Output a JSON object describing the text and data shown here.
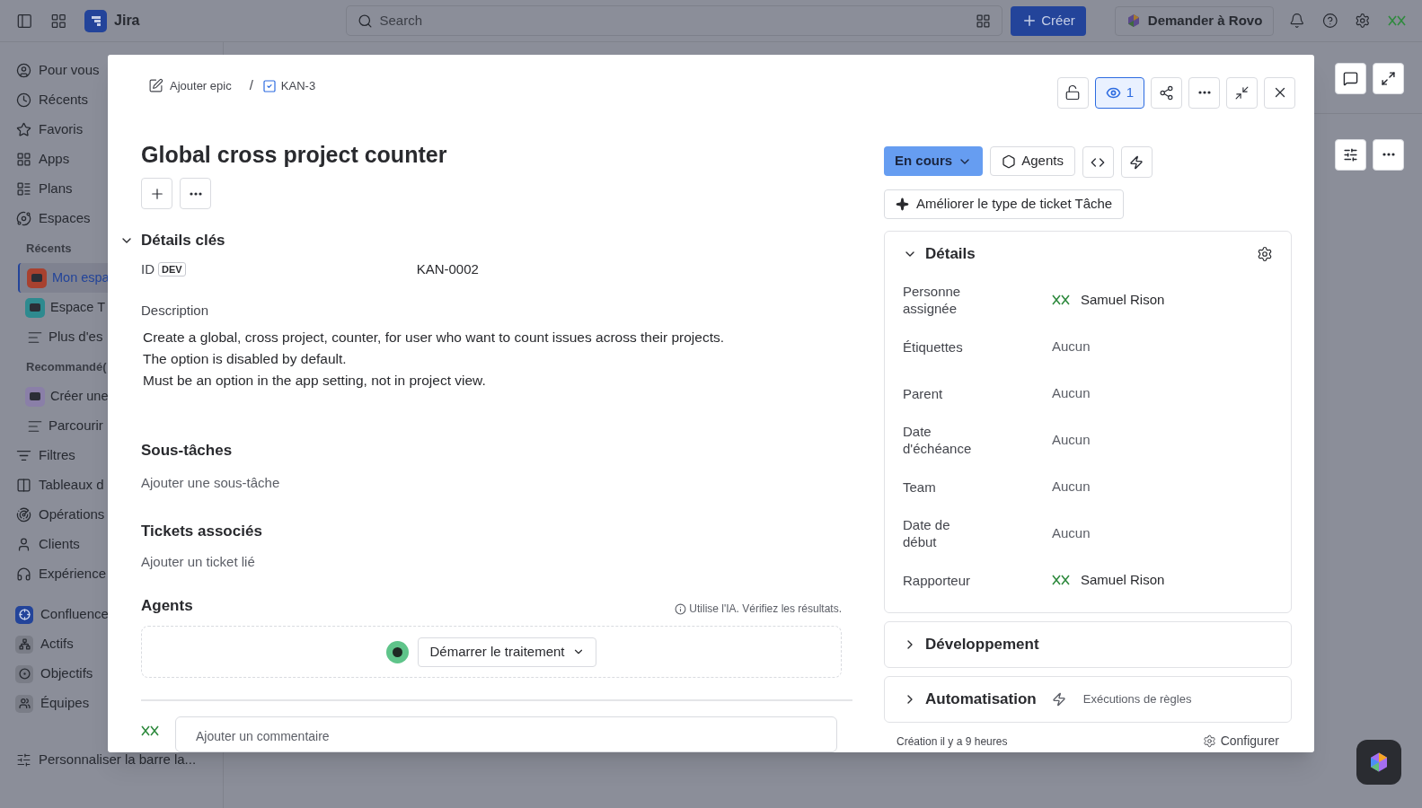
{
  "topbar": {
    "app_name": "Jira",
    "search": {
      "placeholder": "Search"
    },
    "create": "Créer",
    "rovo": "Demander à Rovo"
  },
  "sidebar": {
    "items": [
      {
        "kind": "item",
        "label": "Pour vous",
        "selected": false
      },
      {
        "kind": "item",
        "label": "Récents",
        "selected": false
      },
      {
        "kind": "item",
        "label": "Favoris",
        "selected": false
      },
      {
        "kind": "item",
        "label": "Apps",
        "selected": false
      },
      {
        "kind": "item",
        "label": "Plans",
        "selected": false
      },
      {
        "kind": "item",
        "label": "Espaces",
        "selected": false
      },
      {
        "kind": "heading",
        "label": "Récents"
      },
      {
        "kind": "space",
        "label": "Mon espa",
        "color": "#a8412f",
        "selected": true
      },
      {
        "kind": "space",
        "label": "Espace T",
        "color": "#2e8a8f",
        "selected": false
      },
      {
        "kind": "sub",
        "label": "Plus d'es",
        "selected": false
      },
      {
        "kind": "heading",
        "label": "Recommandé("
      },
      {
        "kind": "space",
        "label": "Créer une",
        "color": "#8a7fa8",
        "selected": false
      },
      {
        "kind": "sub",
        "label": "Parcourir",
        "selected": false
      },
      {
        "kind": "item",
        "label": "Filtres",
        "selected": false
      },
      {
        "kind": "item",
        "label": "Tableaux d",
        "selected": false
      },
      {
        "kind": "item",
        "label": "Opérations",
        "selected": false
      },
      {
        "kind": "item",
        "label": "Clients",
        "selected": false
      },
      {
        "kind": "item",
        "label": "Expérience",
        "selected": false
      },
      {
        "kind": "app",
        "label": "Confluence",
        "color": "#23449a",
        "selected": false
      },
      {
        "kind": "app",
        "label": "Actifs",
        "color": "#7a7d87",
        "selected": false
      },
      {
        "kind": "app",
        "label": "Objectifs",
        "color": "#7a7d87",
        "selected": false
      },
      {
        "kind": "app",
        "label": "Équipes",
        "color": "#7a7d87",
        "selected": false
      }
    ],
    "customize": "Personnaliser la barre la..."
  },
  "issue": {
    "breadcrumbs": [
      {
        "label": "Ajouter epic"
      },
      {
        "label": "KAN-3"
      }
    ],
    "breadcrumb_separator": "/",
    "watchers": "1",
    "title": "Global cross project counter",
    "key_details": {
      "heading": "Détails clés",
      "expanded": true,
      "id_label": "ID",
      "id_badge": "DEV",
      "id_value": "KAN-0002"
    },
    "description": {
      "heading": "Description",
      "lines": [
        "Create a global, cross project, counter, for user who want to count issues across their projects.",
        "The option is disabled by default.",
        "Must be an option in the app setting, not in project view."
      ]
    },
    "subtasks": {
      "heading": "Sous-tâches",
      "action": "Ajouter une sous-tâche"
    },
    "linked": {
      "heading": "Tickets associés",
      "action": "Ajouter un ticket lié"
    },
    "agents": {
      "heading": "Agents",
      "note": "Utilise l'IA. Vérifiez les résultats.",
      "button": "Démarrer le traitement"
    },
    "comment": {
      "placeholder": "Ajouter un commentaire"
    },
    "status": "En cours",
    "agents_button": "Agents",
    "improve": "Améliorer le type de ticket Tâche",
    "details": {
      "heading": "Détails",
      "expanded": true,
      "fields": [
        {
          "label": "Personne assignée",
          "value": "Samuel Rison",
          "kind": "user"
        },
        {
          "label": "Étiquettes",
          "value": "Aucun",
          "kind": "empty"
        },
        {
          "label": "Parent",
          "value": "Aucun",
          "kind": "empty"
        },
        {
          "label": "Date d'échéance",
          "value": "Aucun",
          "kind": "empty"
        },
        {
          "label": "Team",
          "value": "Aucun",
          "kind": "empty"
        },
        {
          "label": "Date de début",
          "value": "Aucun",
          "kind": "empty"
        },
        {
          "label": "Rapporteur",
          "value": "Samuel Rison",
          "kind": "user"
        }
      ]
    },
    "sections": [
      {
        "heading": "Développement",
        "expanded": false
      },
      {
        "heading": "Automatisation",
        "expanded": false,
        "extra": "Exécutions de règles"
      }
    ],
    "footer": {
      "created": "Création il y a 9 heures",
      "configure": "Configurer"
    }
  }
}
